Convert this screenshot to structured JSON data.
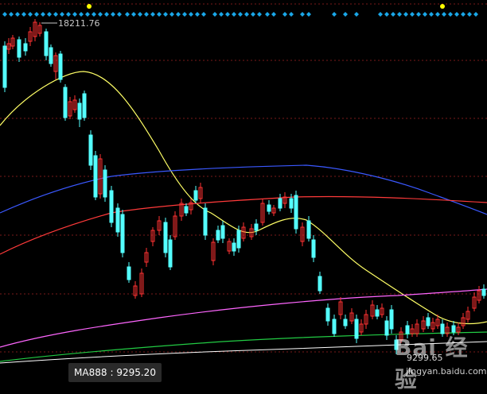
{
  "colors": {
    "background": "#000000",
    "up_candle": "#ff3232",
    "down_candle": "#54ffff",
    "grid": "#7a1a1a",
    "signal_marker": "#1aa7e8",
    "signal_marker_highlight": "#ffff00",
    "ma_short": "#ffff66",
    "ma_blue": "#3a58ff",
    "ma_red": "#ff3a3a",
    "ma_magenta": "#ff66ff",
    "ma_green": "#22cc44",
    "ma_white": "#ffffff"
  },
  "labels": {
    "peak_value": "18211.76",
    "trough_value": "9299.65"
  },
  "ma_indicator": {
    "name": "MA888",
    "value": "9295.20"
  },
  "watermark": {
    "logo": "Bai 经验",
    "url": "jingyan.baidu.com"
  },
  "chart_data": {
    "type": "candlestick",
    "title": "",
    "y_markers": {
      "high": 18211.76,
      "low": 9299.65
    },
    "indicator_line_value": 9295.2,
    "signal_markers_highlight_count": 2
  }
}
